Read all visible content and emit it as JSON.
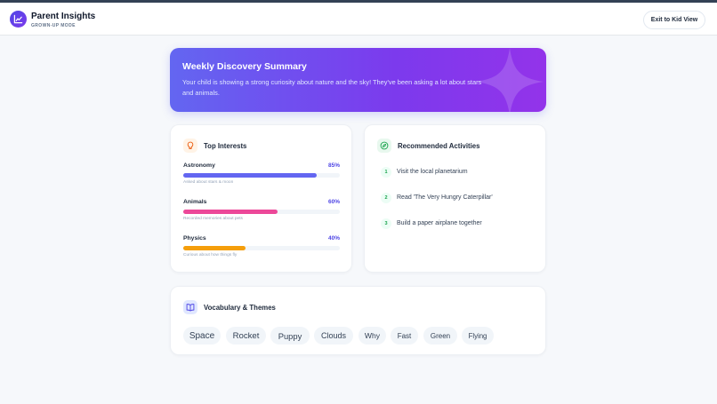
{
  "header": {
    "title": "Parent Insights",
    "subtitle": "GROWN-UP MODE",
    "exit_label": "Exit to Kid View"
  },
  "summary": {
    "title": "Weekly Discovery Summary",
    "body": "Your child is showing a strong curiosity about nature and the sky! They've been asking a lot about stars and animals."
  },
  "interests": {
    "title": "Top Interests",
    "items": [
      {
        "label": "Astronomy",
        "percent_label": "85%",
        "value": 85,
        "note": "Asked about stars & moon",
        "color": "#6366f1"
      },
      {
        "label": "Animals",
        "percent_label": "60%",
        "value": 60,
        "note": "Recorded memories about pets",
        "color": "#ec4899"
      },
      {
        "label": "Physics",
        "percent_label": "40%",
        "value": 40,
        "note": "Curious about how things fly",
        "color": "#f59e0b"
      }
    ]
  },
  "activities": {
    "title": "Recommended Activities",
    "items": [
      {
        "num": "1",
        "text": "Visit the local planetarium"
      },
      {
        "num": "2",
        "text": "Read 'The Very Hungry Caterpillar'"
      },
      {
        "num": "3",
        "text": "Build a paper airplane together"
      }
    ]
  },
  "vocabulary": {
    "title": "Vocabulary & Themes",
    "words": [
      "Space",
      "Rocket",
      "Puppy",
      "Clouds",
      "Why",
      "Fast",
      "Green",
      "Flying"
    ]
  },
  "colors": {
    "accent": "#6366f1",
    "accent_purple": "#9333ea",
    "activity_green": "#16a34a",
    "bulb_orange": "#ea580c"
  },
  "icons": {
    "logo": "trend-chart-icon",
    "sparkle": "sparkle-icon",
    "interests": "lightbulb-icon",
    "activities": "compass-icon",
    "vocabulary": "book-icon"
  }
}
